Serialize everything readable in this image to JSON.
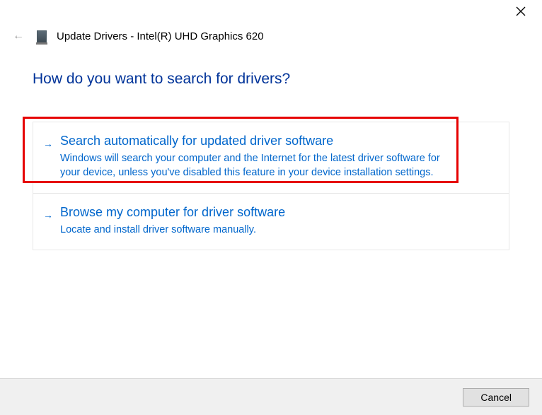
{
  "header": {
    "window_title": "Update Drivers - Intel(R) UHD Graphics 620"
  },
  "main": {
    "question": "How do you want to search for drivers?",
    "options": [
      {
        "title": "Search automatically for updated driver software",
        "description": "Windows will search your computer and the Internet for the latest driver software for your device, unless you've disabled this feature in your device installation settings."
      },
      {
        "title": "Browse my computer for driver software",
        "description": "Locate and install driver software manually."
      }
    ]
  },
  "footer": {
    "cancel_label": "Cancel"
  }
}
